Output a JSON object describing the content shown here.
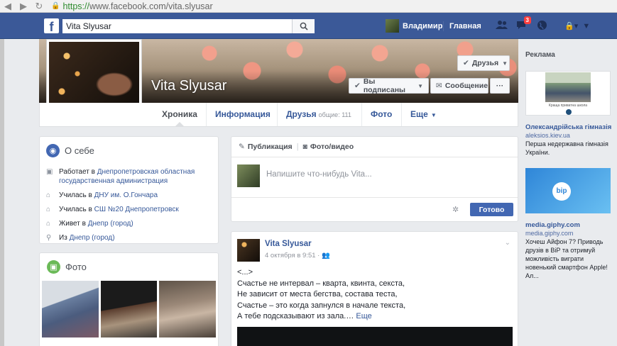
{
  "browser": {
    "url_scheme": "https://",
    "url_host": "www.facebook.com",
    "url_path": "/vita.slyusar",
    "icons": [
      "back-arrow-icon",
      "forward-arrow-icon",
      "reload-icon",
      "lock-icon"
    ]
  },
  "header": {
    "search_value": "Vita Slyusar",
    "user_name": "Владимир",
    "home_label": "Главная",
    "notif_count": "3"
  },
  "profile": {
    "name": "Vita Slyusar",
    "friends_btn": "Друзья",
    "subscribed_btn": "Вы подписаны",
    "message_btn": "Сообщение",
    "more_btn": "···"
  },
  "tabs": [
    {
      "label": "Хроника"
    },
    {
      "label": "Информация"
    },
    {
      "label": "Друзья",
      "count": "общие: 111"
    },
    {
      "label": "Фото"
    },
    {
      "label": "Еще"
    }
  ],
  "about": {
    "title": "О себе",
    "rows": [
      {
        "prefix": "Работает в ",
        "link": "Днепропетровская областная государственная администрация"
      },
      {
        "prefix": "Училась в ",
        "link": "ДНУ им. О.Гончара"
      },
      {
        "prefix": "Училась в ",
        "link": "СШ №20 Днепропетровск"
      },
      {
        "prefix": "Живет в ",
        "link": "Днепр (город)"
      },
      {
        "prefix": "Из ",
        "link": "Днепр (город)"
      }
    ]
  },
  "photos_card": {
    "title": "Фото"
  },
  "composer": {
    "tab_post": "Публикация",
    "tab_media": "Фото/видео",
    "placeholder": "Напишите что-нибудь Vita...",
    "submit": "Готово"
  },
  "post": {
    "author": "Vita Slyusar",
    "time": "4 октября в 9:51 · ",
    "lines": [
      "<...>",
      "Счастье не интервал – кварта, квинта, секста,",
      "Не зависит от места бегства, состава теста,",
      "Счастье – это когда запнулся в начале текста,",
      "А тебе подсказывают из зала.… "
    ],
    "more": "Еще"
  },
  "ads": {
    "heading": "Реклама",
    "items": [
      {
        "thumb_caption": "Краща приватна школа",
        "title": "Олександрійська гімназія",
        "url": "aleksios.kiev.ua",
        "body": "Перша недержавна гімназія України."
      },
      {
        "title": "media.giphy.com",
        "url": "media.giphy.com",
        "body": "Хочеш Айфон 7? Приводь друзів в ВіР та отримуй можливість виграти новенький смартфон Apple! Ал..."
      }
    ]
  },
  "colors": {
    "fb_blue": "#3b5998",
    "link": "#365899",
    "button_blue": "#4267b2",
    "notif_red": "#fa3e3e"
  }
}
